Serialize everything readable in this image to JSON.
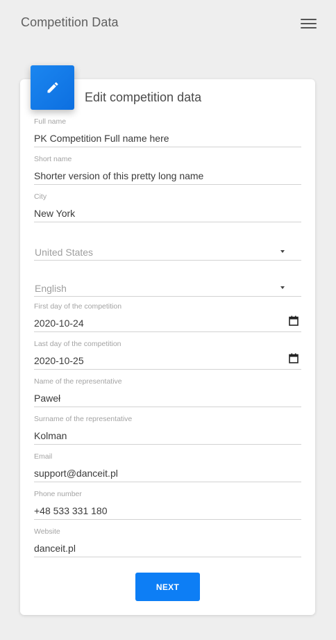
{
  "header": {
    "title": "Competition Data",
    "menu_icon": "hamburger-menu-icon"
  },
  "card": {
    "title": "Edit competition data",
    "icon": "pencil-icon",
    "accent_color": "#0d7ef5"
  },
  "fields": {
    "full_name": {
      "label": "Full name",
      "value": "PK Competition Full name here"
    },
    "short_name": {
      "label": "Short name",
      "value": "Shorter version of this pretty long name"
    },
    "city": {
      "label": "City",
      "value": "New York"
    },
    "country": {
      "value": "United States"
    },
    "language": {
      "value": "English"
    },
    "first_day": {
      "label": "First day of the competition",
      "value": "2020-10-24"
    },
    "last_day": {
      "label": "Last day of the competition",
      "value": "2020-10-25"
    },
    "rep_name": {
      "label": "Name of the representative",
      "value": "Paweł"
    },
    "rep_surname": {
      "label": "Surname of the representative",
      "value": "Kolman"
    },
    "email": {
      "label": "Email",
      "value": "support@danceit.pl"
    },
    "phone": {
      "label": "Phone number",
      "value": "+48 533 331 180"
    },
    "website": {
      "label": "Website",
      "value": "danceit.pl"
    }
  },
  "actions": {
    "next_label": "NEXT"
  }
}
